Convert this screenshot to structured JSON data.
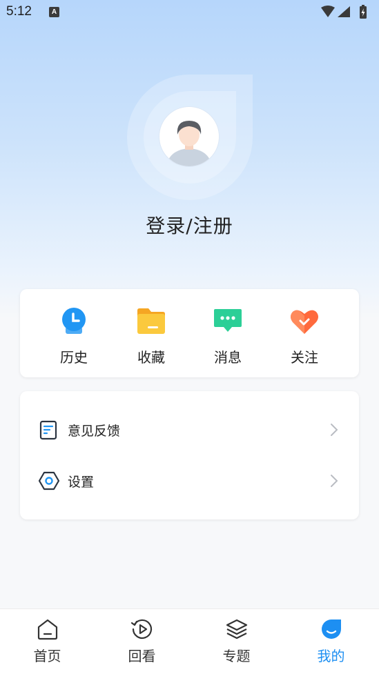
{
  "status_bar": {
    "time": "5:12",
    "notification_badge": "A"
  },
  "profile": {
    "login_label": "登录/注册"
  },
  "quick_actions": [
    {
      "label": "历史",
      "icon": "clock-icon",
      "color": "#2196f3"
    },
    {
      "label": "收藏",
      "icon": "folder-icon",
      "color": "#fbbf24"
    },
    {
      "label": "消息",
      "icon": "chat-bubble-icon",
      "color": "#2ccf97"
    },
    {
      "label": "关注",
      "icon": "heart-icon",
      "color": "#ff6a3d"
    }
  ],
  "menu": [
    {
      "label": "意见反馈",
      "icon": "feedback-icon"
    },
    {
      "label": "设置",
      "icon": "settings-hexagon-icon"
    }
  ],
  "bottom_nav": [
    {
      "label": "首页",
      "icon": "home-icon",
      "active": false
    },
    {
      "label": "回看",
      "icon": "replay-icon",
      "active": false
    },
    {
      "label": "专题",
      "icon": "layers-icon",
      "active": false
    },
    {
      "label": "我的",
      "icon": "profile-icon",
      "active": true
    }
  ],
  "colors": {
    "accent": "#1d8ff2",
    "header_gradient_top": "#b6d6fb",
    "background": "#f7f8fa"
  }
}
